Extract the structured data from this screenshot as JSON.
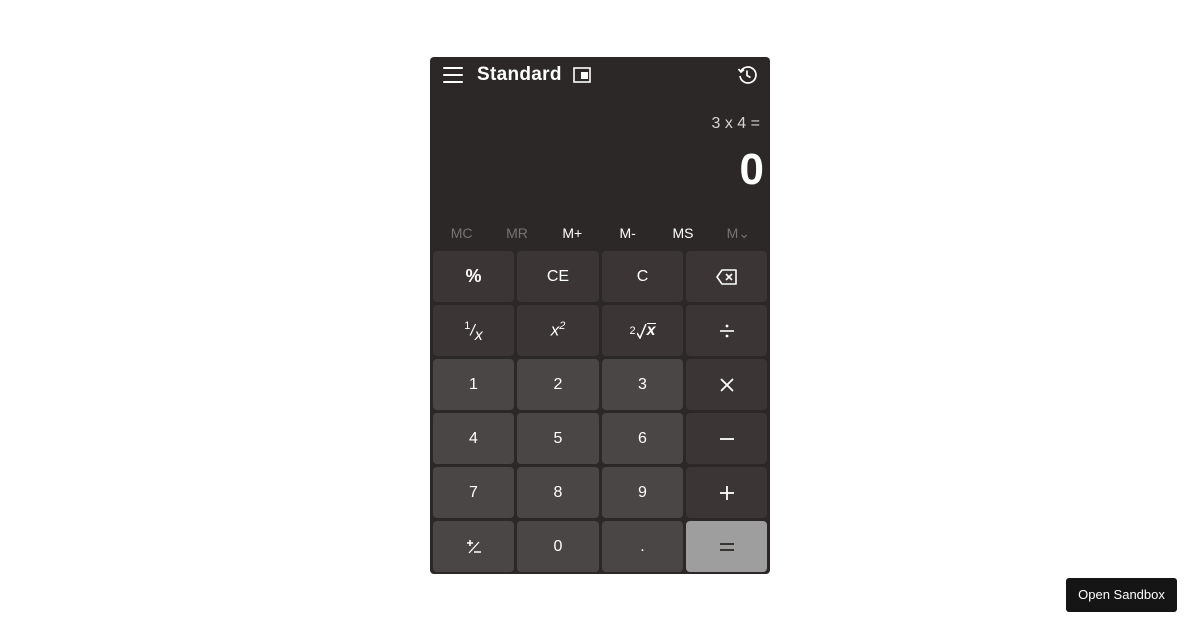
{
  "header": {
    "title": "Standard",
    "icons": [
      "menu-icon",
      "keep-on-top-icon",
      "history-icon"
    ]
  },
  "display": {
    "expression": "3 x 4 =",
    "result": "0"
  },
  "memory": [
    {
      "label": "MC",
      "enabled": false
    },
    {
      "label": "MR",
      "enabled": false
    },
    {
      "label": "M+",
      "enabled": true
    },
    {
      "label": "M-",
      "enabled": true
    },
    {
      "label": "MS",
      "enabled": true
    },
    {
      "label": "M⌄",
      "enabled": false
    }
  ],
  "keys": {
    "percent": "%",
    "ce": "CE",
    "c": "C",
    "one": "1",
    "two": "2",
    "three": "3",
    "four": "4",
    "five": "5",
    "six": "6",
    "seven": "7",
    "eight": "8",
    "nine": "9",
    "zero": "0",
    "decimal": ".",
    "reciprocal_num": "1",
    "reciprocal_den": "x",
    "square_base": "x",
    "square_exp": "2",
    "root_index": "2",
    "root_radicand": "x"
  },
  "sandbox_button": "Open Sandbox",
  "colors": {
    "window_bg": "#2d2828",
    "fn_key_bg": "#3b3535",
    "num_key_bg": "#4a4646",
    "equals_bg": "#9e9e9e"
  }
}
